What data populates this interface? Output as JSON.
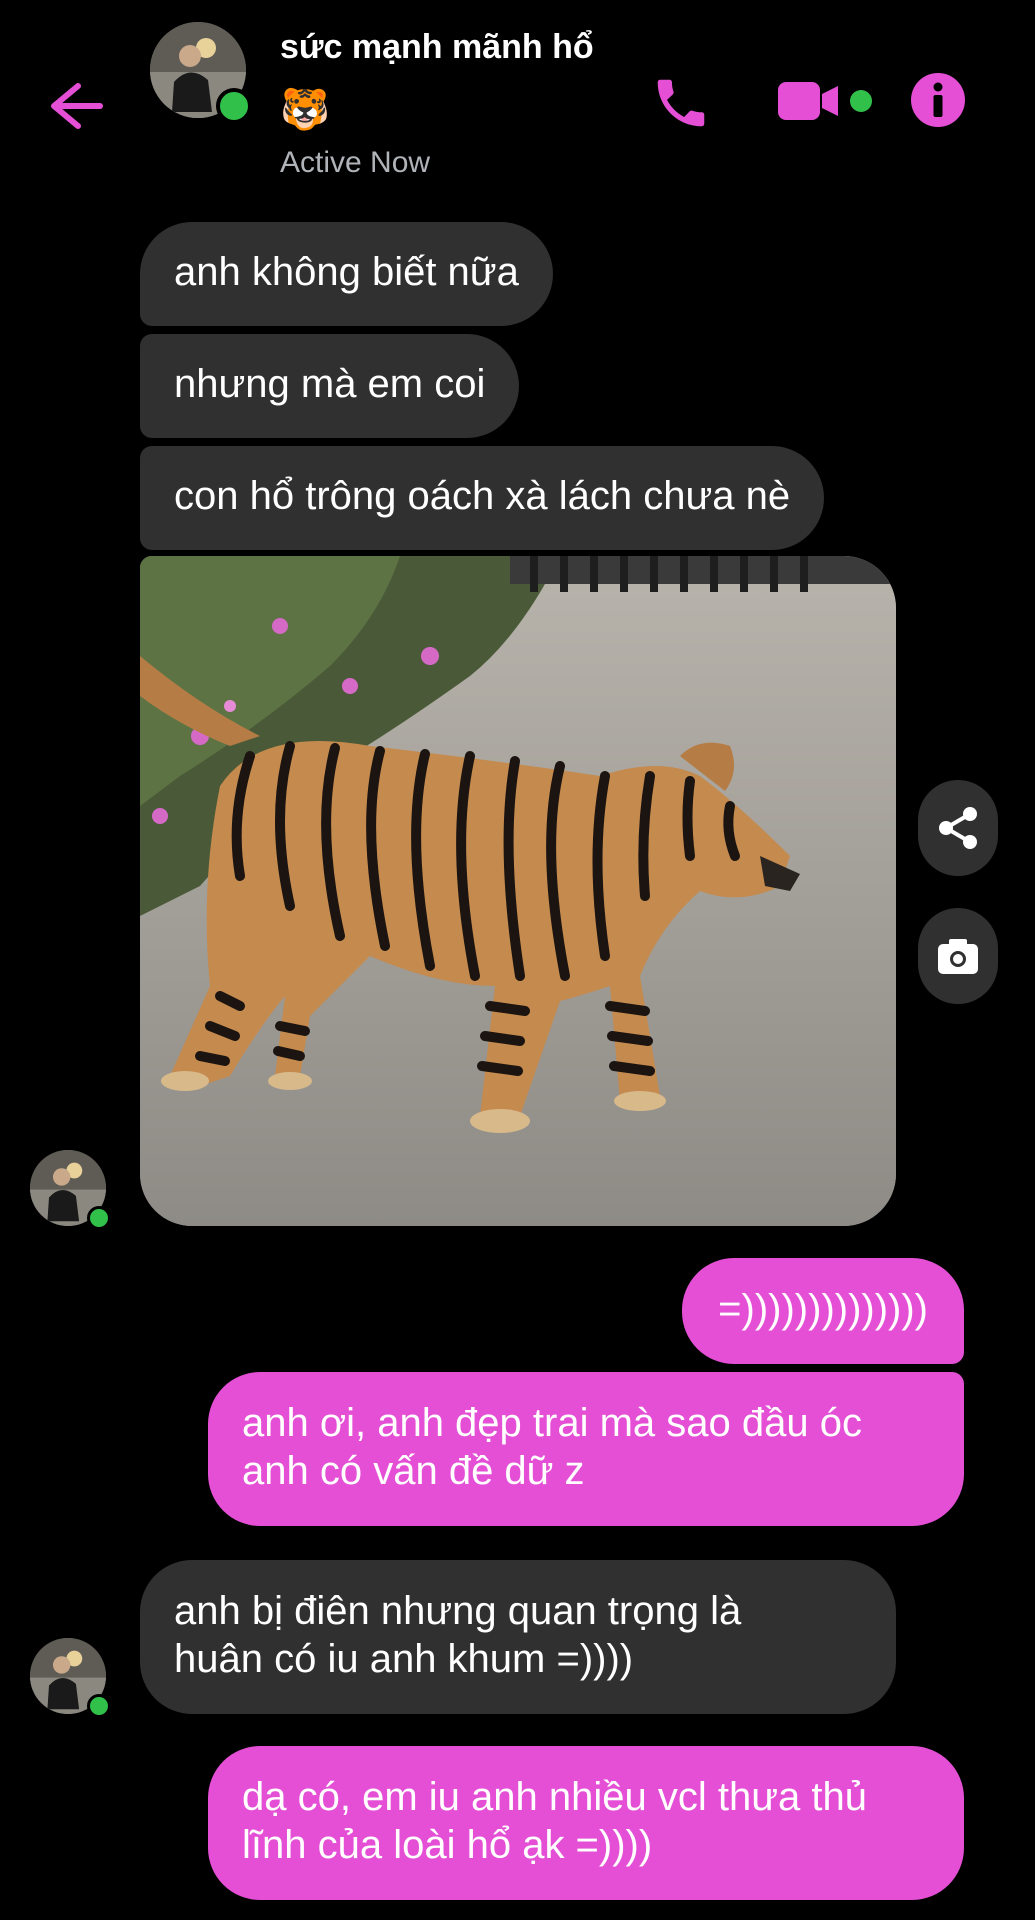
{
  "header": {
    "contact_name": "sức mạnh mãnh hổ",
    "contact_emoji": "🐯",
    "status": "Active Now",
    "back_icon": "arrow-left-icon",
    "call_icon": "phone-icon",
    "video_icon": "video-camera-icon",
    "info_icon": "info-icon"
  },
  "colors": {
    "accent": "#e44fd6",
    "incoming_bubble": "#303030",
    "online": "#31c14a",
    "background": "#000000"
  },
  "messages": [
    {
      "direction": "incoming",
      "text": "anh không biết nữa"
    },
    {
      "direction": "incoming",
      "text": "nhưng mà em coi"
    },
    {
      "direction": "incoming",
      "text": "con hổ trông oách xà lách chưa nè"
    },
    {
      "direction": "incoming",
      "type": "photo",
      "subject": "dog painted with tiger stripes"
    },
    {
      "direction": "outgoing",
      "text": "=))))))))))))))"
    },
    {
      "direction": "outgoing",
      "lines": [
        "anh ơi, anh đẹp trai mà sao đầu óc",
        "anh có vấn đề dữ z"
      ]
    },
    {
      "direction": "incoming",
      "lines": [
        "anh bị điên nhưng quan trọng là",
        "huân có iu anh khum =))))"
      ]
    },
    {
      "direction": "outgoing",
      "lines": [
        "dạ có, em iu anh nhiều vcl thưa thủ",
        "lĩnh của loài hổ ạk =))))"
      ]
    }
  ],
  "photo_actions": {
    "share_icon": "share-icon",
    "camera_icon": "camera-icon"
  }
}
